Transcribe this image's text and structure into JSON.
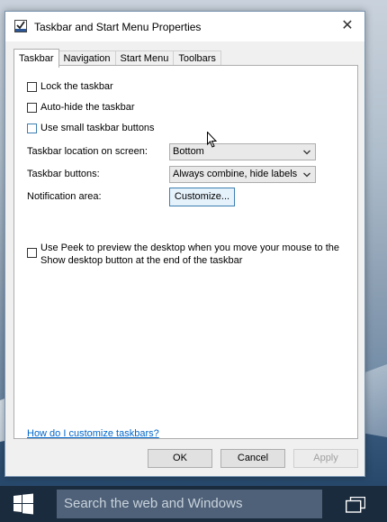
{
  "window": {
    "title": "Taskbar and Start Menu Properties",
    "close_glyph": "✕"
  },
  "tabs": [
    {
      "label": "Taskbar",
      "active": true
    },
    {
      "label": "Navigation",
      "active": false
    },
    {
      "label": "Start Menu",
      "active": false
    },
    {
      "label": "Toolbars",
      "active": false
    }
  ],
  "options": {
    "lock": "Lock the taskbar",
    "autohide": "Auto-hide the taskbar",
    "small_buttons": "Use small taskbar buttons"
  },
  "location": {
    "label": "Taskbar location on screen:",
    "value": "Bottom"
  },
  "buttons_setting": {
    "label": "Taskbar buttons:",
    "value": "Always combine, hide labels"
  },
  "notification": {
    "label": "Notification area:",
    "button": "Customize..."
  },
  "peek": {
    "line1": "Use Peek to preview the desktop when you move your mouse to the",
    "line2": "Show desktop button at the end of the taskbar"
  },
  "help_link": "How do I customize taskbars?",
  "footer": {
    "ok": "OK",
    "cancel": "Cancel",
    "apply": "Apply"
  },
  "taskbar": {
    "search_placeholder": "Search the web and Windows"
  },
  "colors": {
    "accent": "#3c7fb1",
    "link": "#0066cc",
    "taskbar": "#1a2b3d"
  }
}
